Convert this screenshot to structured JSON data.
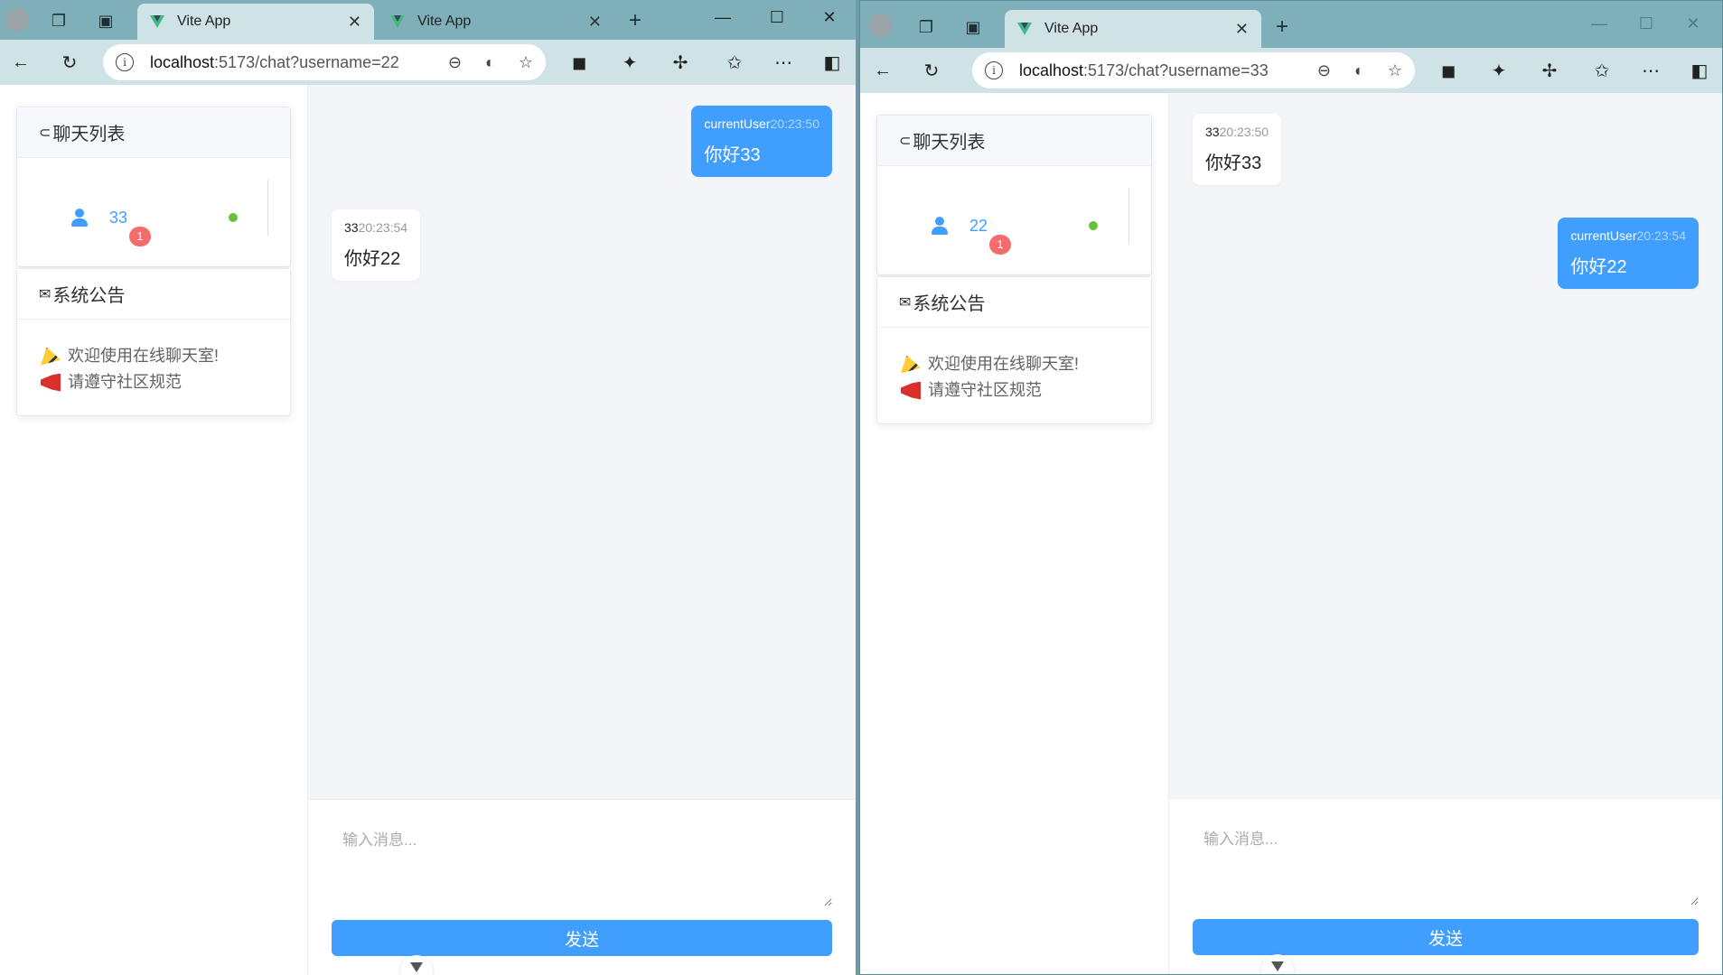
{
  "left_window": {
    "tabs": [
      {
        "title": "Vite App",
        "active": true
      },
      {
        "title": "Vite App",
        "active": false
      }
    ],
    "url": {
      "host": "localhost",
      "path": ":5173/chat?username=22"
    },
    "chat_list_title": "聊天列表",
    "contact": {
      "name": "33",
      "unread": "1",
      "online": true
    },
    "notice_title": "系统公告",
    "notices": [
      "欢迎使用在线聊天室!",
      "请遵守社区规范"
    ],
    "messages": [
      {
        "direction": "out",
        "sender": "currentUser",
        "time": "20:23:50",
        "text": "你好33"
      },
      {
        "direction": "in",
        "sender": "33",
        "time": "20:23:54",
        "text": "你好22"
      }
    ],
    "input_placeholder": "输入消息...",
    "send_label": "发送"
  },
  "right_window": {
    "tabs": [
      {
        "title": "Vite App",
        "active": true
      }
    ],
    "url": {
      "host": "localhost",
      "path": ":5173/chat?username=33"
    },
    "chat_list_title": "聊天列表",
    "contact": {
      "name": "22",
      "unread": "1",
      "online": true
    },
    "notice_title": "系统公告",
    "notices": [
      "欢迎使用在线聊天室!",
      "请遵守社区规范"
    ],
    "messages": [
      {
        "direction": "in",
        "sender": "33",
        "time": "20:23:50",
        "text": "你好33"
      },
      {
        "direction": "out",
        "sender": "currentUser",
        "time": "20:23:54",
        "text": "你好22"
      }
    ],
    "input_placeholder": "输入消息...",
    "send_label": "发送"
  },
  "colors": {
    "primary": "#409eff",
    "badge": "#f56c6c",
    "online": "#67c23a",
    "titlebar": "#7fb0ba"
  }
}
